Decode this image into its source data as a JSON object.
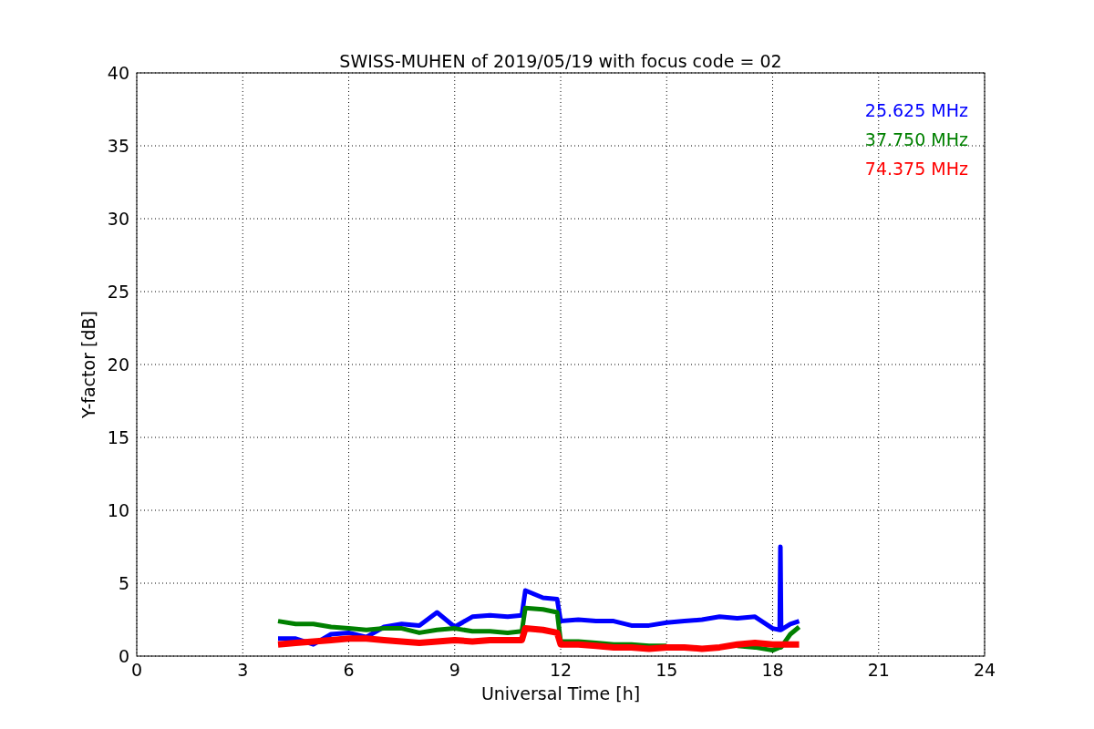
{
  "chart_data": {
    "type": "line",
    "title": "SWISS-MUHEN of 2019/05/19 with focus code = 02",
    "xlabel": "Universal Time [h]",
    "ylabel": "Y-factor [dB]",
    "xlim": [
      0,
      24
    ],
    "ylim": [
      0,
      40
    ],
    "grid": true,
    "xticks": [
      0,
      3,
      6,
      9,
      12,
      15,
      18,
      21,
      24
    ],
    "yticks": [
      0,
      5,
      10,
      15,
      20,
      25,
      30,
      35,
      40
    ],
    "x": [
      4,
      4.5,
      5,
      5.5,
      6,
      6.5,
      7,
      7.5,
      8,
      8.5,
      9,
      9.5,
      10,
      10.5,
      10.9,
      11,
      11.5,
      11.9,
      12,
      12.5,
      13,
      13.5,
      14,
      14.5,
      15,
      15.5,
      16,
      16.5,
      17,
      17.5,
      18,
      18.2,
      18.22,
      18.24,
      18.5,
      18.75
    ],
    "series": [
      {
        "name": "25.625 MHz",
        "color": "#0000ff",
        "values": [
          1.2,
          1.2,
          0.8,
          1.5,
          1.6,
          1.3,
          2.0,
          2.2,
          2.1,
          3.0,
          2.0,
          2.7,
          2.8,
          2.7,
          2.8,
          4.5,
          4.0,
          3.9,
          2.4,
          2.5,
          2.4,
          2.4,
          2.1,
          2.1,
          2.3,
          2.4,
          2.5,
          2.7,
          2.6,
          2.7,
          1.9,
          1.8,
          7.5,
          1.8,
          2.2,
          2.4
        ]
      },
      {
        "name": "37.750 MHz",
        "color": "#008000",
        "values": [
          2.4,
          2.2,
          2.2,
          2.0,
          1.9,
          1.8,
          1.9,
          1.9,
          1.6,
          1.8,
          1.9,
          1.7,
          1.7,
          1.6,
          1.7,
          3.3,
          3.2,
          3.0,
          1.0,
          1.0,
          0.9,
          0.8,
          0.8,
          0.7,
          0.7,
          null,
          null,
          null,
          0.7,
          0.6,
          0.4,
          0.6,
          0.6,
          0.6,
          1.5,
          2.0
        ]
      },
      {
        "name": "74.375 MHz",
        "color": "#ff0000",
        "values": [
          0.8,
          0.9,
          1.0,
          1.1,
          1.2,
          1.2,
          1.1,
          1.0,
          0.9,
          1.0,
          1.1,
          1.0,
          1.1,
          1.1,
          1.1,
          1.9,
          1.8,
          1.6,
          0.8,
          0.8,
          0.7,
          0.6,
          0.6,
          0.5,
          0.6,
          0.6,
          0.5,
          0.6,
          0.8,
          0.9,
          0.8,
          0.8,
          0.8,
          0.8,
          0.8,
          0.8
        ]
      }
    ]
  }
}
